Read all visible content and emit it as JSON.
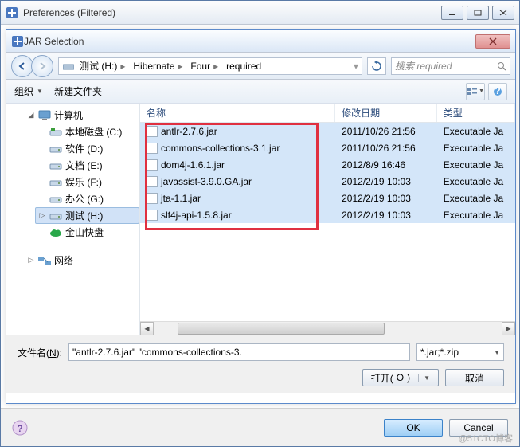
{
  "outer": {
    "title": "Preferences (Filtered)"
  },
  "inner": {
    "title": "JAR Selection"
  },
  "breadcrumb": {
    "root_label": "测试 (H:)",
    "parts": [
      "Hibernate",
      "Four",
      "required"
    ]
  },
  "search": {
    "placeholder": "搜索 required"
  },
  "toolbar": {
    "organize": "组织",
    "newfolder": "新建文件夹"
  },
  "columns": {
    "name": "名称",
    "date": "修改日期",
    "type": "类型"
  },
  "tree": {
    "computer": "计算机",
    "items": [
      {
        "label": "本地磁盘 (C:)",
        "icon": "drive-c",
        "color": "#3b9e3b"
      },
      {
        "label": "软件 (D:)",
        "icon": "drive",
        "color": "#7a95b0"
      },
      {
        "label": "文档 (E:)",
        "icon": "drive",
        "color": "#7a95b0"
      },
      {
        "label": "娱乐 (F:)",
        "icon": "drive",
        "color": "#7a95b0"
      },
      {
        "label": "办公 (G:)",
        "icon": "drive",
        "color": "#7a95b0"
      },
      {
        "label": "测试 (H:)",
        "icon": "drive",
        "color": "#7a95b0",
        "selected": true
      },
      {
        "label": "金山快盘",
        "icon": "cloud",
        "color": "#2aa84a"
      }
    ],
    "network": "网络"
  },
  "files": [
    {
      "name": "antlr-2.7.6.jar",
      "date": "2011/10/26 21:56",
      "type": "Executable Ja"
    },
    {
      "name": "commons-collections-3.1.jar",
      "date": "2011/10/26 21:56",
      "type": "Executable Ja"
    },
    {
      "name": "dom4j-1.6.1.jar",
      "date": "2012/8/9 16:46",
      "type": "Executable Ja"
    },
    {
      "name": "javassist-3.9.0.GA.jar",
      "date": "2012/2/19 10:03",
      "type": "Executable Ja"
    },
    {
      "name": "jta-1.1.jar",
      "date": "2012/2/19 10:03",
      "type": "Executable Ja"
    },
    {
      "name": "slf4j-api-1.5.8.jar",
      "date": "2012/2/19 10:03",
      "type": "Executable Ja"
    }
  ],
  "filename": {
    "label_pre": "文件名(",
    "label_key": "N",
    "label_post": "):",
    "value": "\"antlr-2.7.6.jar\" \"commons-collections-3.",
    "filter": "*.jar;*.zip"
  },
  "buttons": {
    "open_pre": "打开(",
    "open_key": "O",
    "open_post": ")",
    "cancel_inner": "取消",
    "ok": "OK",
    "cancel_outer": "Cancel"
  },
  "watermark": "@51CTO博客"
}
